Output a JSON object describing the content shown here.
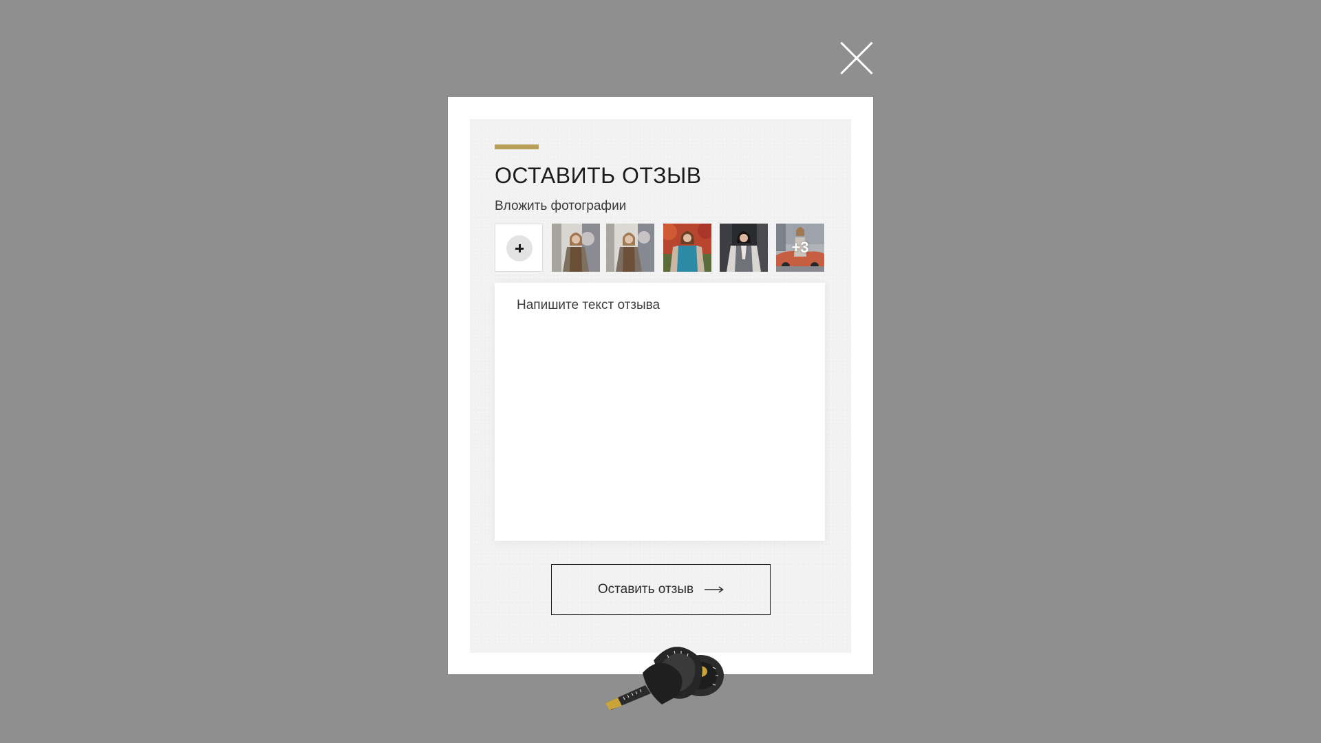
{
  "modal": {
    "title": "ОСТАВИТЬ ОТЗЫВ",
    "attach_label": "Вложить фотографии",
    "more_photos_label": "+3",
    "textarea_placeholder": "Напишите текст отзыва",
    "submit_label": "Оставить отзыв"
  },
  "icons": {
    "close": "close-icon",
    "add_photo": "plus-icon",
    "submit_arrow": "arrow-right-icon",
    "decoration": "tape-measure-icon"
  },
  "colors": {
    "overlay": "#8f8f8f",
    "accent": "#b9a05a",
    "panel": "#f2f2f2"
  }
}
